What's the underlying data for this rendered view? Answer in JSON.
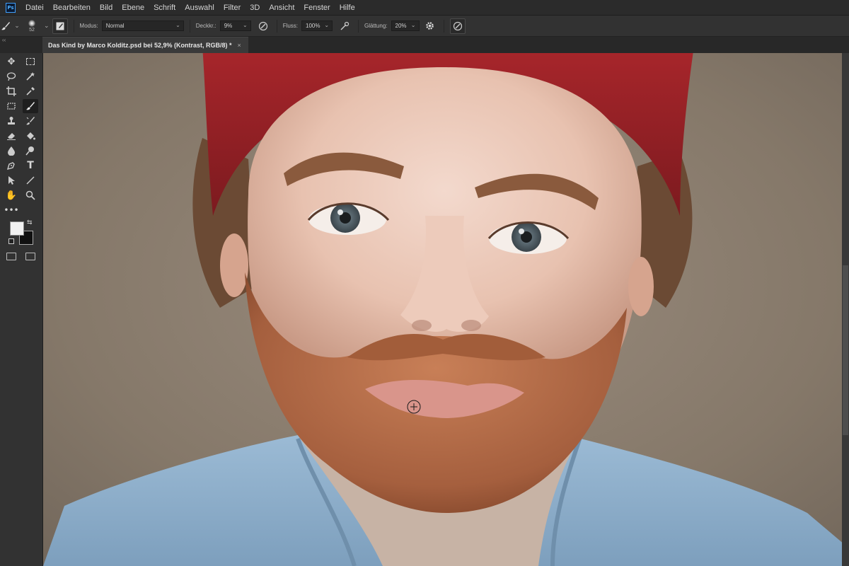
{
  "app": {
    "logo": "Ps"
  },
  "menu": [
    "Datei",
    "Bearbeiten",
    "Bild",
    "Ebene",
    "Schrift",
    "Auswahl",
    "Filter",
    "3D",
    "Ansicht",
    "Fenster",
    "Hilfe"
  ],
  "options": {
    "brush_size": "52",
    "mode_label": "Modus:",
    "mode_value": "Normal",
    "opacity_label": "Deckkr.:",
    "opacity_value": "9%",
    "flow_label": "Fluss:",
    "flow_value": "100%",
    "smoothing_label": "Glättung:",
    "smoothing_value": "20%"
  },
  "document": {
    "tab_title": "Das Kind by Marco Kolditz.psd bei 52,9% (Kontrast, RGB/8) *",
    "close": "×"
  },
  "colors": {
    "foreground": "#f1f1f1",
    "background": "#111111",
    "accent": "#31a8ff"
  },
  "icons": {
    "tools": [
      "move-icon",
      "marquee-icon",
      "lasso-icon",
      "magic-wand-icon",
      "crop-icon",
      "eyedropper-icon",
      "frame-icon",
      "brush-icon",
      "stamp-icon",
      "history-brush-icon",
      "eraser-icon",
      "paint-bucket-icon",
      "blur-icon",
      "dodge-icon",
      "pen-icon",
      "type-icon",
      "path-select-icon",
      "line-icon",
      "hand-icon",
      "zoom-icon",
      "more-tools-icon"
    ]
  }
}
